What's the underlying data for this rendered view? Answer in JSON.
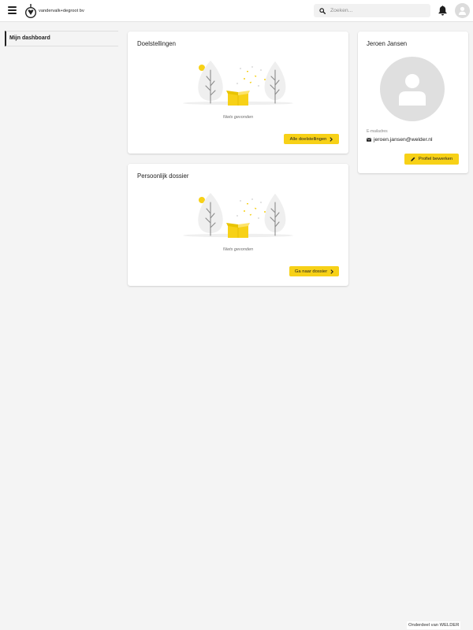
{
  "header": {
    "logo_text": "vandervalk+degroot bv",
    "search_placeholder": "Zoeken..."
  },
  "sidebar": {
    "items": [
      {
        "label": "Mijn dashboard",
        "active": true
      }
    ]
  },
  "cards": {
    "goals": {
      "title": "Doelstellingen",
      "empty_text": "Niets gevonden",
      "button_label": "Alle doelstellingen"
    },
    "dossier": {
      "title": "Persoonlijk dossier",
      "empty_text": "Niets gevonden",
      "button_label": "Ga naar dossier"
    }
  },
  "profile": {
    "name": "Jeroen Jansen",
    "email_label": "E-mailadres",
    "email": "jeroen.jansen@welder.nl",
    "edit_button_label": "Profiel bewerken"
  },
  "footer": {
    "text": "Onderdeel van WELDER"
  },
  "icons": {
    "menu": "hamburger-menu-icon",
    "logo": "logo-icon",
    "search": "search-icon",
    "notifications": "bell-icon",
    "avatar": "user-icon",
    "button_arrow": "chevron-right-icon",
    "email": "envelope-icon",
    "edit": "pencil-icon",
    "empty_state": "empty-box-trees-illustration"
  },
  "colors": {
    "accent": "#f7d117",
    "page_background": "#f4f4f4",
    "card_background": "#ffffff",
    "text": "#222222",
    "avatar_placeholder": "#dfdfdf"
  }
}
